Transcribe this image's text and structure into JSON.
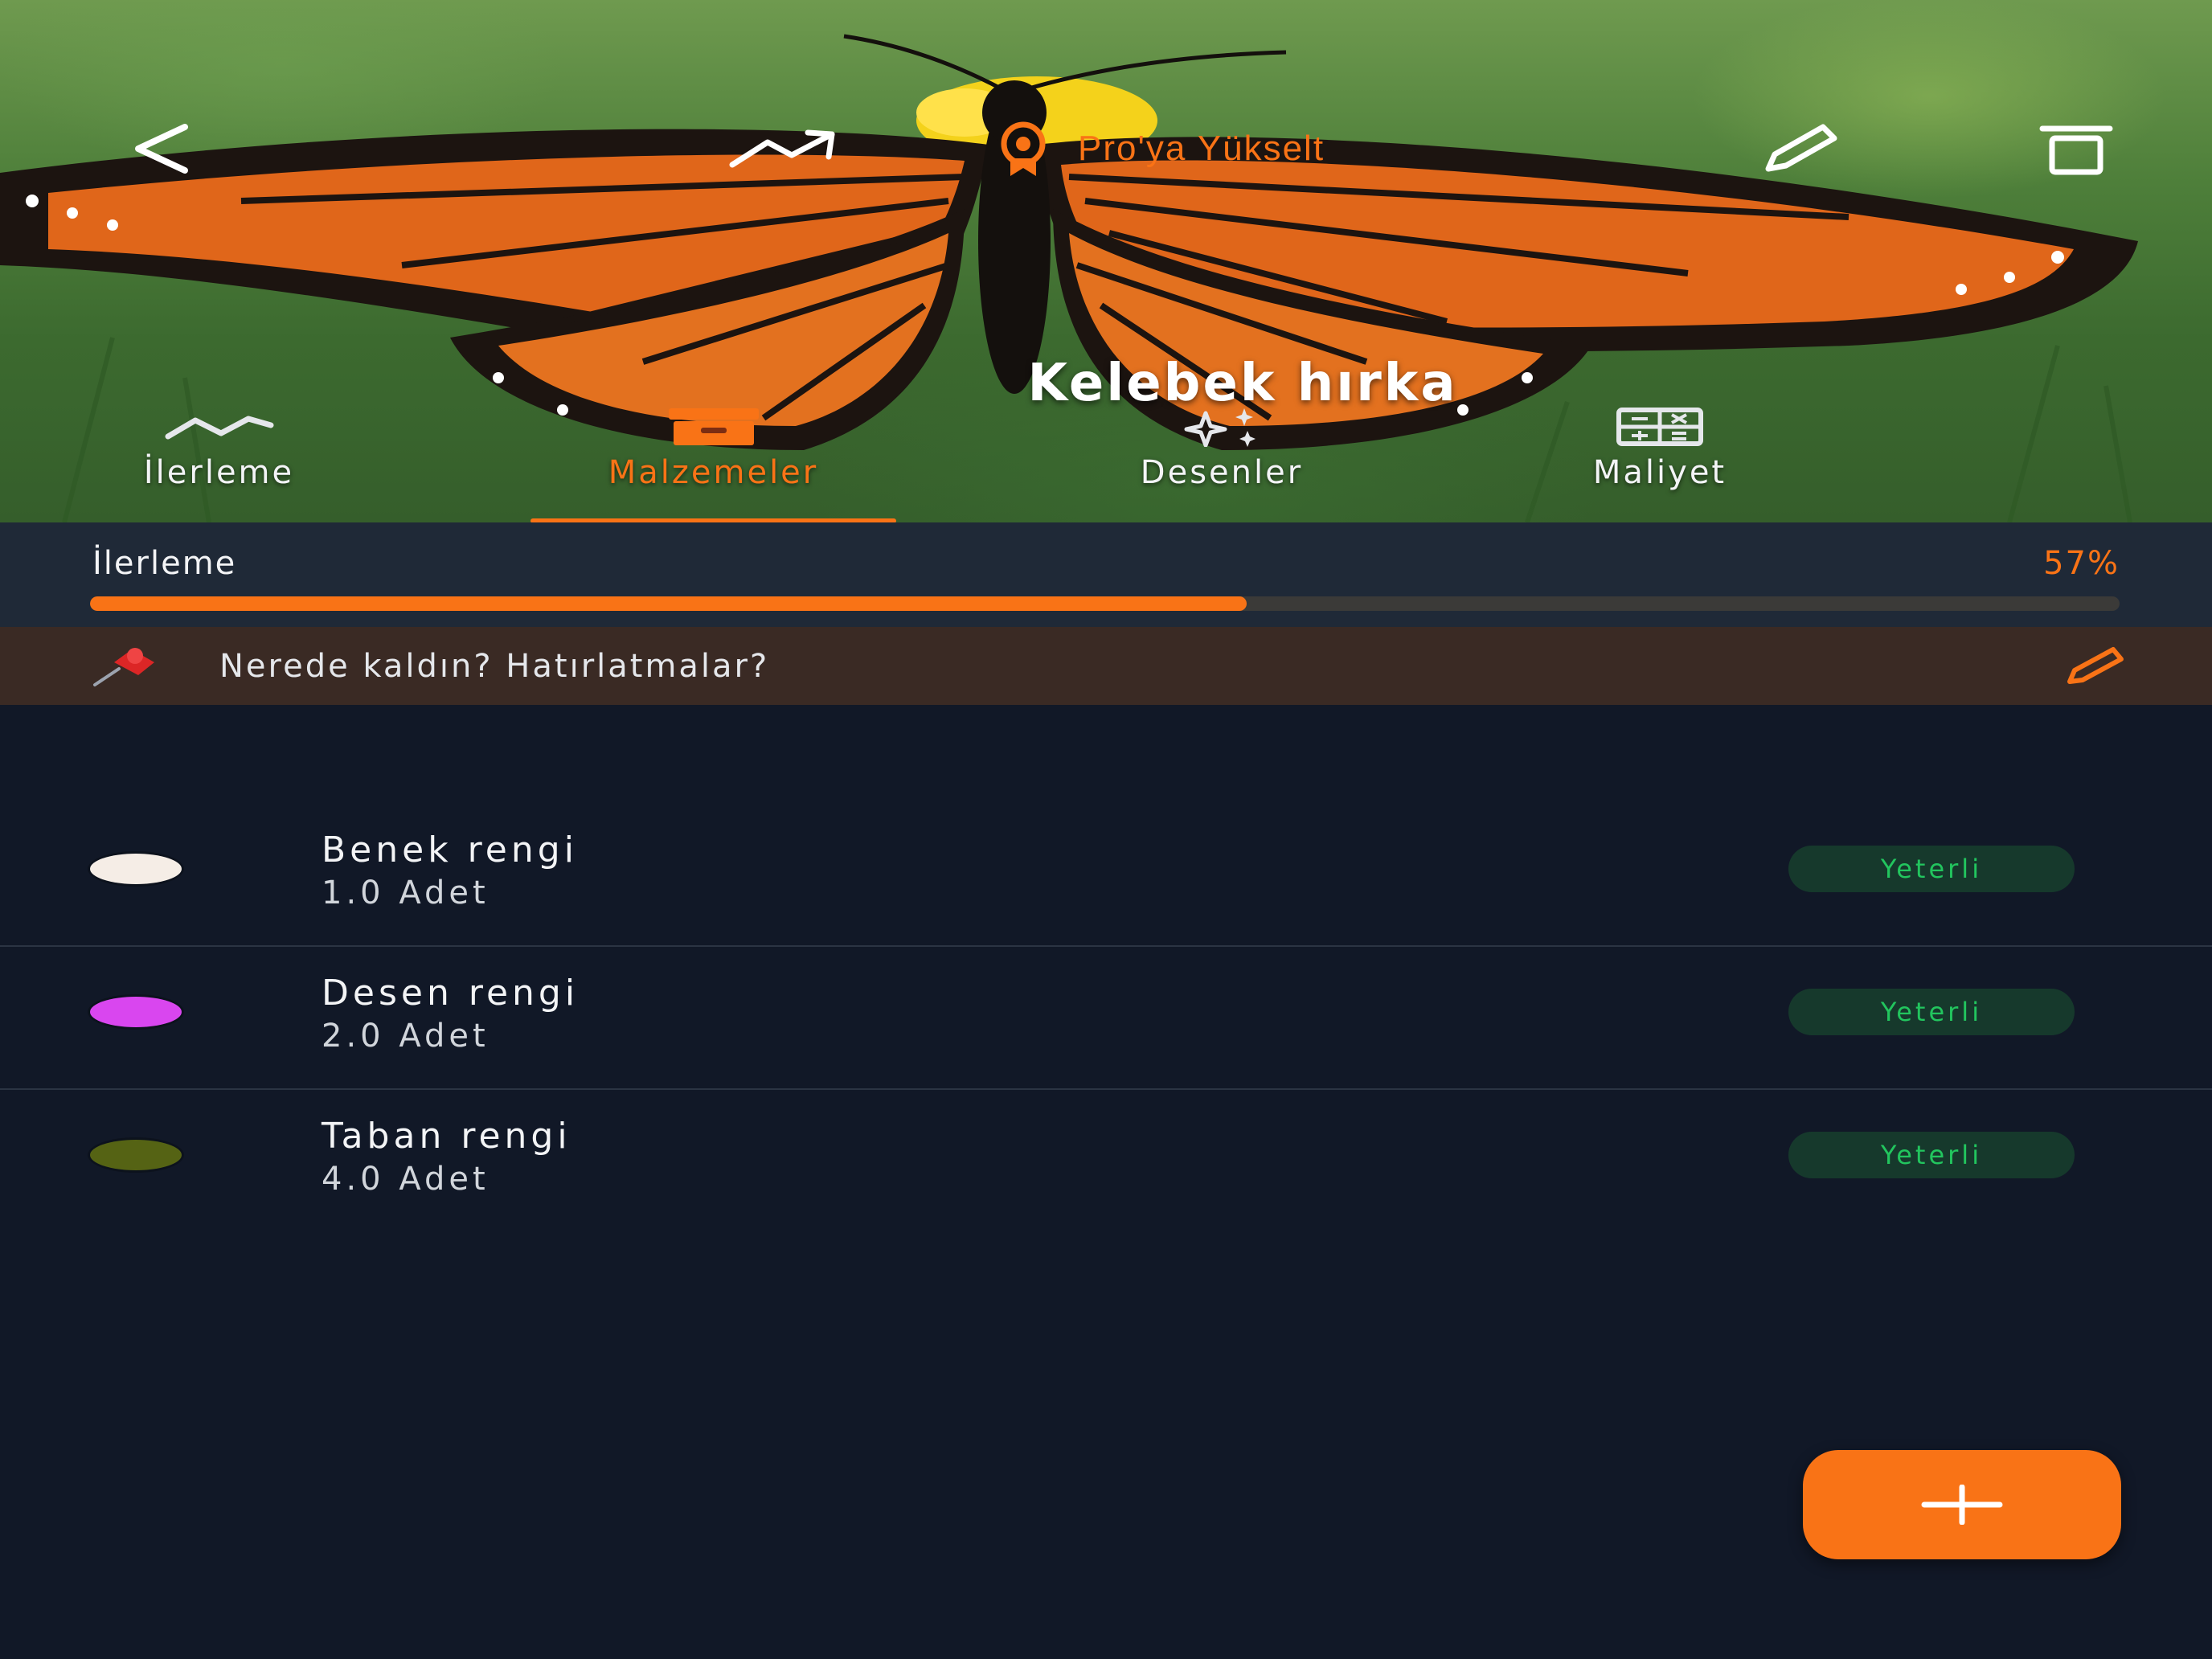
{
  "header": {
    "pro_label": "Pro'ya Yükselt",
    "title": "Kelebek hırka"
  },
  "tabs": [
    {
      "label": "İlerleme",
      "icon": "chart-line-icon",
      "active": false
    },
    {
      "label": "Malzemeler",
      "icon": "archive-box-icon",
      "active": true
    },
    {
      "label": "Desenler",
      "icon": "sparkles-icon",
      "active": false
    },
    {
      "label": "Maliyet",
      "icon": "calculator-icon",
      "active": false
    }
  ],
  "progress": {
    "label": "İlerleme",
    "value_text": "57%",
    "value": 0.57
  },
  "note": {
    "text": "Nerede kaldın? Hatırlatmalar?"
  },
  "materials": [
    {
      "name": "Benek rengi",
      "quantity": "1.0 Adet",
      "status": "Yeterli",
      "color": "#f5ede6"
    },
    {
      "name": "Desen rengi",
      "quantity": "2.0 Adet",
      "status": "Yeterli",
      "color": "#d946ef"
    },
    {
      "name": "Taban rengi",
      "quantity": "4.0 Adet",
      "status": "Yeterli",
      "color": "#556314"
    }
  ],
  "colors": {
    "accent": "#f97316",
    "background": "#111827",
    "status_ok": "#22c55e"
  }
}
